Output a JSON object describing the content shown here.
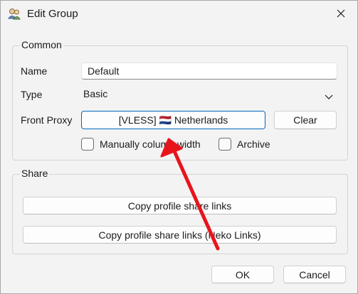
{
  "window": {
    "title": "Edit Group"
  },
  "common": {
    "legend": "Common",
    "name_label": "Name",
    "name_value": "Default",
    "type_label": "Type",
    "type_value": "Basic",
    "front_proxy_label": "Front Proxy",
    "front_proxy_value": "[VLESS] 🇳🇱 Netherlands",
    "clear_label": "Clear",
    "manually_column_width_label": "Manually column width",
    "archive_label": "Archive"
  },
  "share": {
    "legend": "Share",
    "copy_links_label": "Copy profile share links",
    "copy_neko_links_label": "Copy profile share links (Neko Links)"
  },
  "footer": {
    "ok_label": "OK",
    "cancel_label": "Cancel"
  },
  "annotation": {
    "arrow_color": "#e8141c"
  },
  "colors": {
    "focus_border": "#0067c0",
    "window_bg": "#f3f3f3"
  }
}
